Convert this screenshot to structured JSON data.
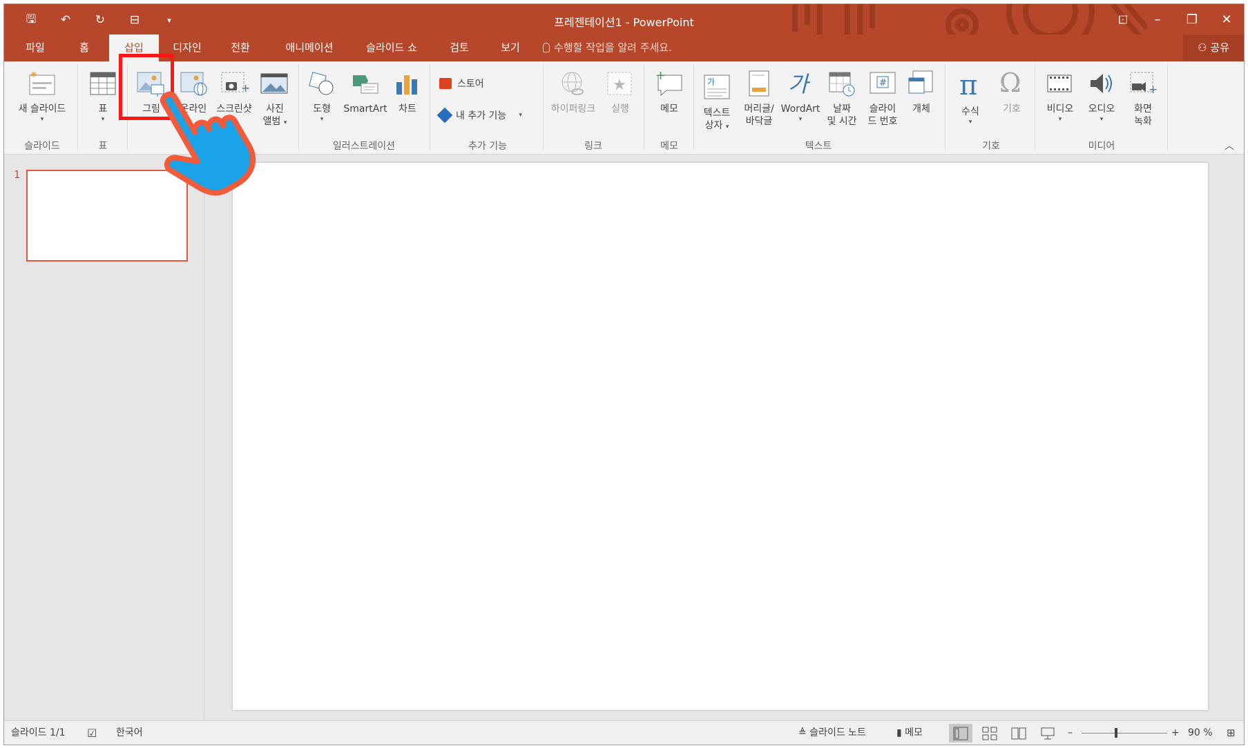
{
  "window": {
    "title": "프레젠테이션1 - PowerPoint"
  },
  "qat": {
    "items": [
      {
        "name": "save-icon",
        "glyph": "🖫"
      },
      {
        "name": "undo-icon",
        "glyph": "↶"
      },
      {
        "name": "redo-icon",
        "glyph": "↻"
      },
      {
        "name": "present-icon",
        "glyph": "⊟"
      },
      {
        "name": "customize-icon",
        "glyph": "▾"
      }
    ]
  },
  "window_controls": {
    "ribbon_display": "⊡",
    "minimize": "–",
    "restore": "❐",
    "close": "✕"
  },
  "tabs": [
    {
      "label": "파일",
      "active": false
    },
    {
      "label": "홈",
      "active": false
    },
    {
      "label": "삽입",
      "active": true
    },
    {
      "label": "디자인",
      "active": false
    },
    {
      "label": "전환",
      "active": false
    },
    {
      "label": "애니메이션",
      "active": false
    },
    {
      "label": "슬라이드 쇼",
      "active": false
    },
    {
      "label": "검토",
      "active": false
    },
    {
      "label": "보기",
      "active": false
    }
  ],
  "tell_me": "수행할 작업을 알려 주세요.",
  "share": "공유",
  "ribbon": {
    "new_slide": "새 슬라이드",
    "table": "표",
    "picture": "그림",
    "online_picture": "온라인",
    "screenshot": "스크린샷",
    "album_line1": "사진",
    "album_line2": "앨범",
    "shapes": "도형",
    "smartart": "SmartArt",
    "chart": "차트",
    "store": "스토어",
    "my_addins": "내 추가 기능",
    "hyperlink": "하이퍼링크",
    "action": "실행",
    "comment": "메모",
    "textbox_line1": "텍스트",
    "textbox_line2": "상자",
    "header_line1": "머리글/",
    "header_line2": "바닥글",
    "wordart": "WordArt",
    "datetime_line1": "날짜",
    "datetime_line2": "및 시간",
    "slidenum_line1": "슬라이",
    "slidenum_line2": "드 번호",
    "object": "개체",
    "equation": "수식",
    "symbol": "기호",
    "video": "비디오",
    "audio": "오디오",
    "screenrec_line1": "화면",
    "screenrec_line2": "녹화",
    "groups": {
      "slides": "슬라이드",
      "tables": "표",
      "illustrations": "일러스트레이션",
      "addins": "추가 기능",
      "links": "링크",
      "comments": "메모",
      "text": "텍스트",
      "symbols": "기호",
      "media": "미디어"
    }
  },
  "thumbnails": {
    "slide_number": "1"
  },
  "statusbar": {
    "slide_info": "슬라이드 1/1",
    "language": "한국어",
    "notes": "슬라이드 노트",
    "comments": "메모",
    "zoom_out": "–",
    "zoom_in": "+",
    "zoom": "90 %",
    "zoom_level": 0.9
  },
  "colors": {
    "accent": "#b7472a",
    "highlight": "#ff1616",
    "hand": "#1aa3e8"
  }
}
